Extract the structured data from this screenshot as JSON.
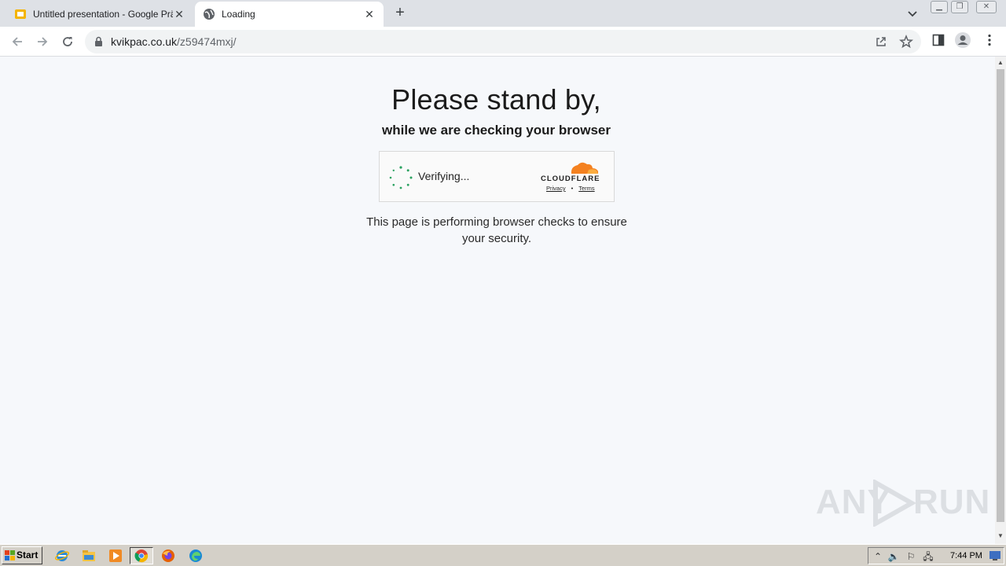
{
  "browser": {
    "tabs": [
      {
        "title": "Untitled presentation - Google Präsentationen",
        "icon": "google-slides-icon",
        "active": false
      },
      {
        "title": "Loading",
        "icon": "globe-icon",
        "active": true
      }
    ],
    "new_tab_symbol": "+",
    "close_symbol": "✕",
    "address": {
      "host": "kvikpac.co.uk",
      "path": "/z59474mxj/"
    }
  },
  "page": {
    "heading": "Please stand by,",
    "subheading": "while we are checking your browser",
    "widget": {
      "status": "Verifying...",
      "brand": "CLOUDFLARE",
      "links": [
        "Privacy",
        "Terms"
      ],
      "separator": "•"
    },
    "description": "This page is performing browser checks to ensure your security."
  },
  "watermark": {
    "left": "ANY",
    "right": "RUN"
  },
  "taskbar": {
    "start_label": "Start",
    "clock": "7:44 PM",
    "pinned": [
      "internet-explorer-icon",
      "file-explorer-icon",
      "media-player-icon",
      "chrome-icon",
      "firefox-icon",
      "edge-icon"
    ]
  },
  "colors": {
    "accent_cloudflare": "#f48120",
    "spinner": "#2aa160",
    "page_bg": "#f6f8fb"
  }
}
